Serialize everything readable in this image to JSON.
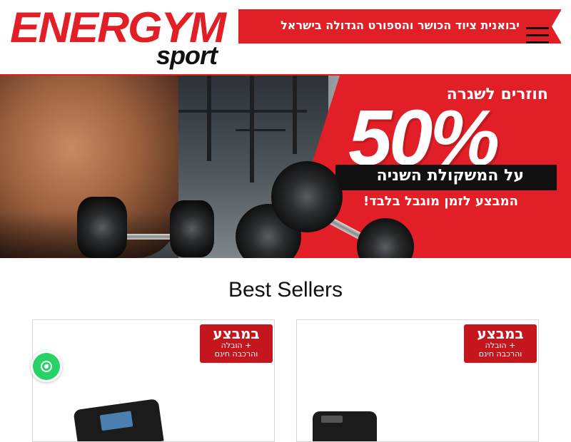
{
  "header": {
    "logo_main": "ENERGYM",
    "logo_sub": "sport",
    "tagline": "יבואנית ציוד הכושר והספורט הגדולה בישראל",
    "menu_icon": "hamburger-menu-icon"
  },
  "banner": {
    "promo_top": "חוזרים לשגרה",
    "promo_big": "50%",
    "promo_mid": "על המשקולת השניה",
    "promo_low": "המבצע לזמן מוגבל בלבד!"
  },
  "best_sellers": {
    "title": "Best Sellers",
    "products": [
      {
        "badge_title": "במבצע",
        "badge_sub_1": "+ הובלה",
        "badge_sub_2": "והרכבה חינם"
      },
      {
        "badge_title": "במבצע",
        "badge_sub_1": "+ הובלה",
        "badge_sub_2": "והרכבה חינם"
      }
    ]
  },
  "whatsapp": {
    "icon": "whatsapp-icon"
  },
  "colors": {
    "brand_red": "#e21f26",
    "badge_red": "#c5161d",
    "whatsapp_green": "#25d366"
  }
}
